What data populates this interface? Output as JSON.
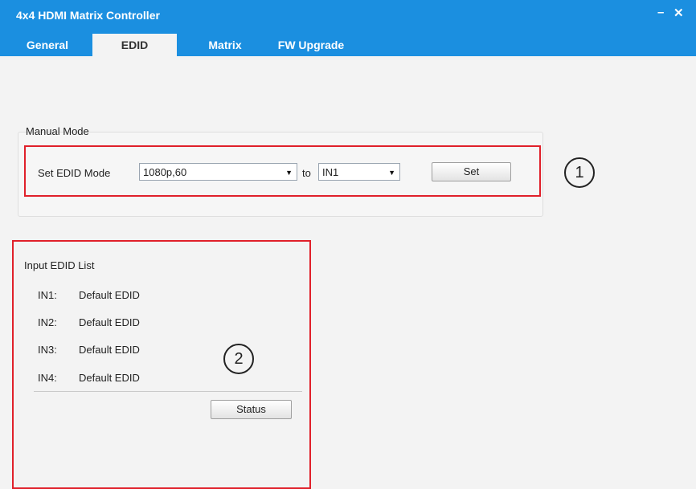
{
  "window": {
    "title": "4x4 HDMI Matrix Controller",
    "minimize_glyph": "–",
    "close_glyph": "✕"
  },
  "tabs": [
    {
      "label": "General",
      "active": false
    },
    {
      "label": "EDID",
      "active": true
    },
    {
      "label": "Matrix",
      "active": false
    },
    {
      "label": "FW Upgrade",
      "active": false
    }
  ],
  "manual_mode": {
    "group_label": "Manual Mode",
    "set_label": "Set EDID Mode",
    "edid_select_value": "1080p,60",
    "to_label": "to",
    "input_select_value": "IN1",
    "set_button": "Set"
  },
  "input_edid_list": {
    "group_label": "Input EDID List",
    "rows": [
      {
        "input": "IN1:",
        "value": "Default EDID"
      },
      {
        "input": "IN2:",
        "value": "Default EDID"
      },
      {
        "input": "IN3:",
        "value": "Default EDID"
      },
      {
        "input": "IN4:",
        "value": "Default EDID"
      }
    ],
    "status_button": "Status"
  },
  "callouts": {
    "one": "1",
    "two": "2"
  },
  "colors": {
    "titlebar": "#1b8fe0",
    "highlight_box": "#e0202a",
    "background": "#f3f3f3"
  },
  "icons": {
    "dropdown": "chevron-down-icon"
  }
}
